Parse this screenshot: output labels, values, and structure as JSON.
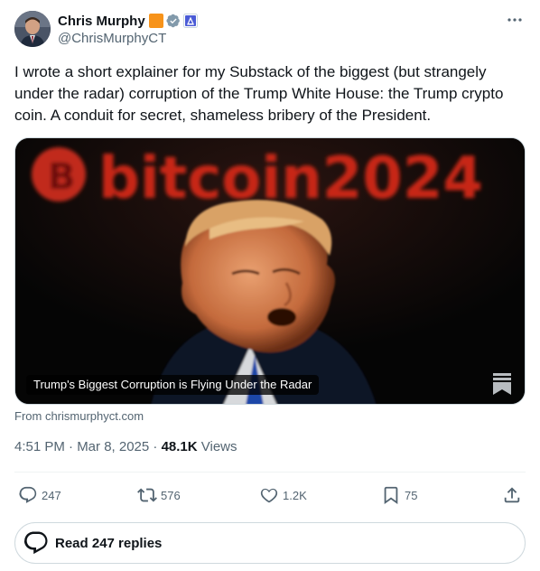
{
  "author": {
    "display_name": "Chris Murphy",
    "handle": "@ChrisMurphyCT",
    "badges": [
      "orange-square-icon",
      "verified-badge-icon",
      "government-flag-icon"
    ]
  },
  "tweet": {
    "text": "I wrote a short explainer for my Substack of the biggest (but strangely under the radar) corruption of the Trump White House: the Trump crypto coin. A conduit for secret, shameless bribery of the President."
  },
  "card": {
    "image_text": "bitcoin2024",
    "title": "Trump's Biggest Corruption is Flying Under the Radar",
    "source": "From chrismurphyct.com"
  },
  "meta": {
    "timestamp": "4:51 PM · Mar 8, 2025 · ",
    "views_count": "48.1K",
    "views_label": " Views"
  },
  "actions": {
    "replies": "247",
    "reposts": "576",
    "likes": "1.2K",
    "bookmarks": "75"
  },
  "read_replies": {
    "label": "Read 247 replies"
  },
  "colors": {
    "text_primary": "#0f1419",
    "text_secondary": "#536471",
    "border": "#cfd9de",
    "verified_gray": "#829aab",
    "orange": "#f7931a"
  }
}
